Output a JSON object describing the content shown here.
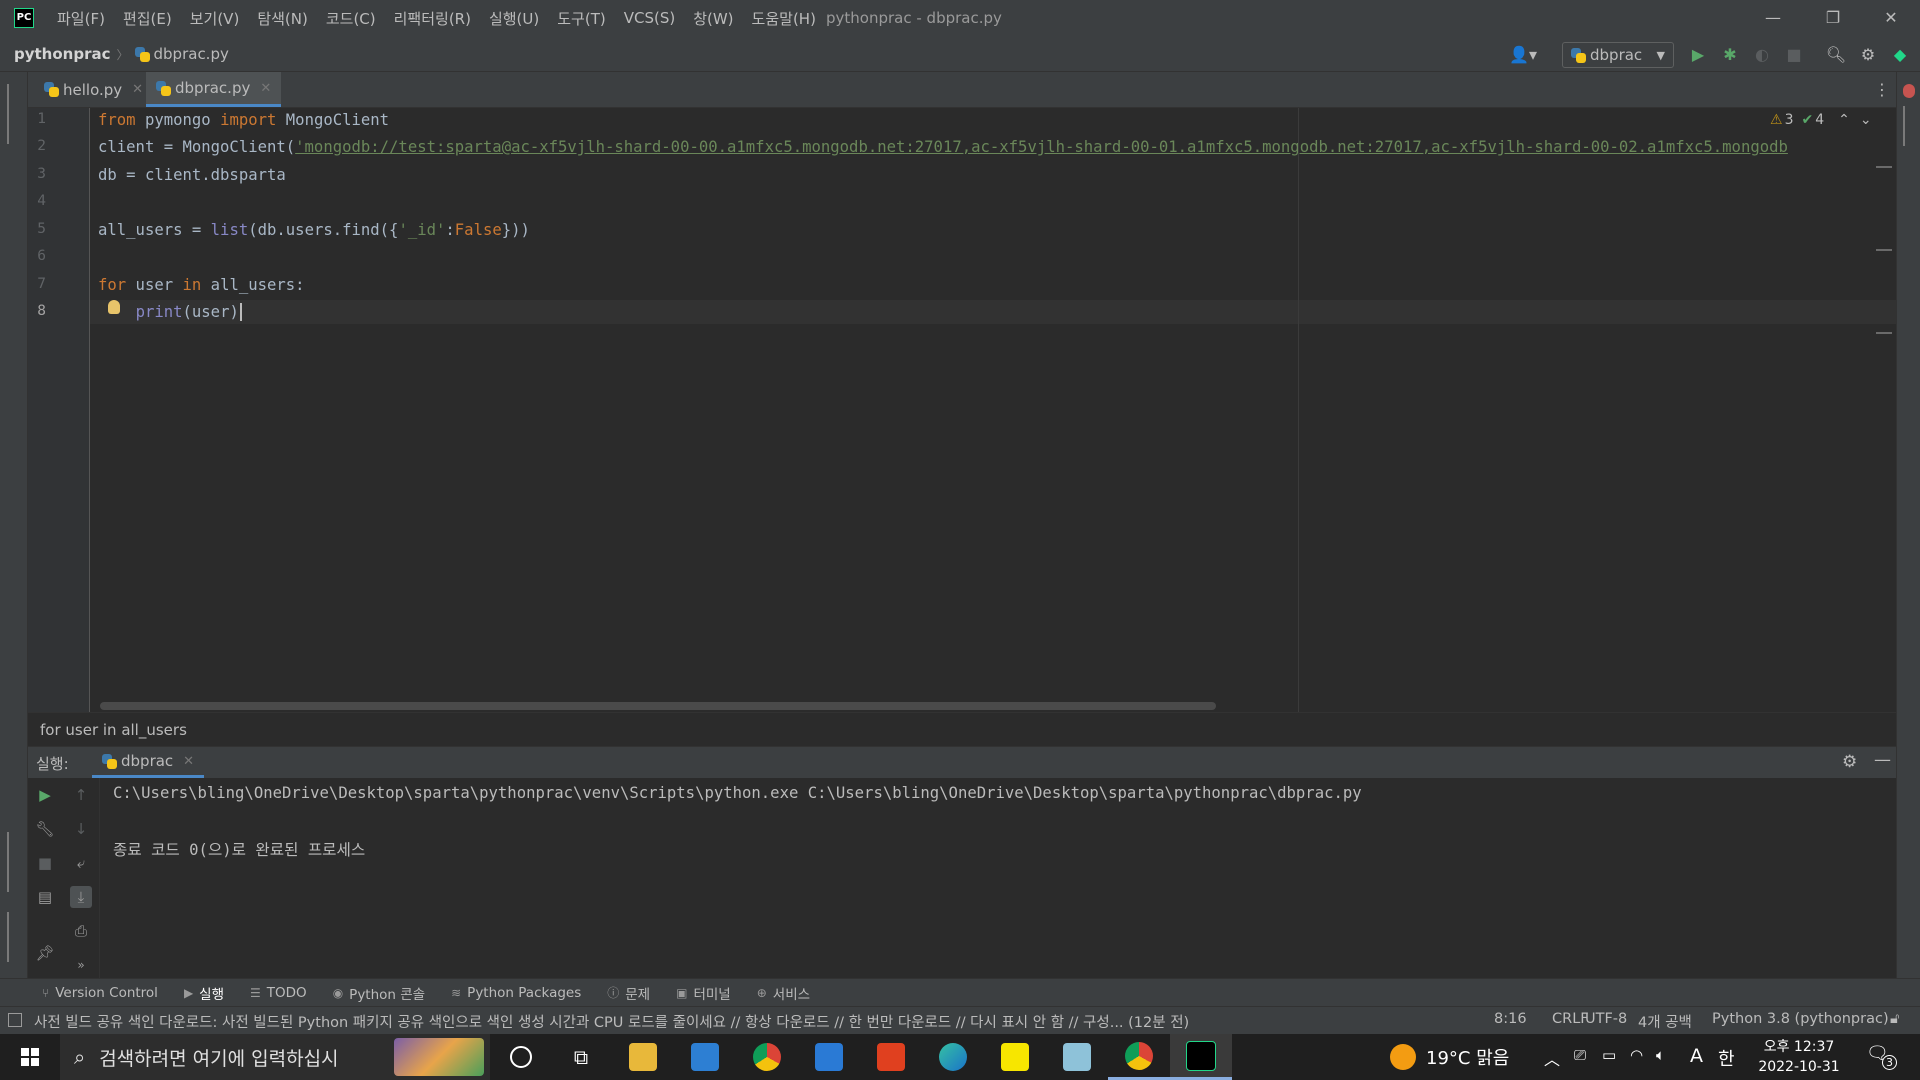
{
  "titlebar": {
    "menu": [
      "파일(F)",
      "편집(E)",
      "보기(V)",
      "탐색(N)",
      "코드(C)",
      "리팩터링(R)",
      "실행(U)",
      "도구(T)",
      "VCS(S)",
      "창(W)",
      "도움말(H)"
    ],
    "title": "pythonprac - dbprac.py",
    "logo": "PC"
  },
  "navbar": {
    "project": "pythonprac",
    "file": "dbprac.py",
    "run_config": "dbprac"
  },
  "tabs": [
    {
      "label": "hello.py",
      "active": false
    },
    {
      "label": "dbprac.py",
      "active": true
    }
  ],
  "editor": {
    "line_numbers": [
      "1",
      "2",
      "3",
      "4",
      "5",
      "6",
      "7",
      "8"
    ],
    "current_line": "8",
    "inspections": {
      "warnings": "3",
      "ok": "4"
    },
    "lines": {
      "l1": {
        "kw1": "from",
        "mod": " pymongo ",
        "kw2": "import",
        "rest": " MongoClient"
      },
      "l2": {
        "pre": "client = MongoClient(",
        "str": "'mongodb://test:sparta@ac-xf5vjlh-shard-00-00.a1mfxc5.mongodb.net:27017,ac-xf5vjlh-shard-00-01.a1mfxc5.mongodb.net:27017,ac-xf5vjlh-shard-00-02.a1mfxc5.mongodb"
      },
      "l3": {
        "text": "db = client.dbsparta"
      },
      "l5": {
        "pre": "all_users = ",
        "bi": "list",
        "mid": "(db.users.find({",
        "str": "'_id'",
        "colon": ":",
        "kw": "False",
        "post": "}))"
      },
      "l7": {
        "kw1": "for",
        "mid1": " user ",
        "kw2": "in",
        "mid2": " all_users:"
      },
      "l8": {
        "indent": "    ",
        "bi": "print",
        "post": "(user)"
      }
    }
  },
  "breadcrumb_bottom": "for user in all_users",
  "run_panel": {
    "label": "실행:",
    "tab": "dbprac",
    "console": [
      "C:\\Users\\bling\\OneDrive\\Desktop\\sparta\\pythonprac\\venv\\Scripts\\python.exe C:\\Users\\bling\\OneDrive\\Desktop\\sparta\\pythonprac\\dbprac.py",
      "",
      "종료 코드 0(으)로 완료된 프로세스"
    ]
  },
  "tool_windows": [
    "Version Control",
    "실행",
    "TODO",
    "Python 콘솔",
    "Python Packages",
    "문제",
    "터미널",
    "서비스"
  ],
  "statusbar": {
    "message": "사전 빌드 공유 색인 다운로드: 사전 빌드된 Python 패키지 공유 색인으로 색인 생성 시간과 CPU 로드를 줄이세요 // 항상 다운로드 // 한 번만 다운로드 // 다시 표시 안 함 // 구성... (12분 전)",
    "position": "8:16",
    "line_sep": "CRLF",
    "encoding": "UTF-8",
    "indent": "4개 공백",
    "interpreter": "Python 3.8 (pythonprac)"
  },
  "taskbar": {
    "search_placeholder": "검색하려면 여기에 입력하십시",
    "weather": "19°C  맑음",
    "ime1": "A",
    "ime2": "한",
    "time": "오후 12:37",
    "date": "2022-10-31",
    "notif_count": "3"
  }
}
